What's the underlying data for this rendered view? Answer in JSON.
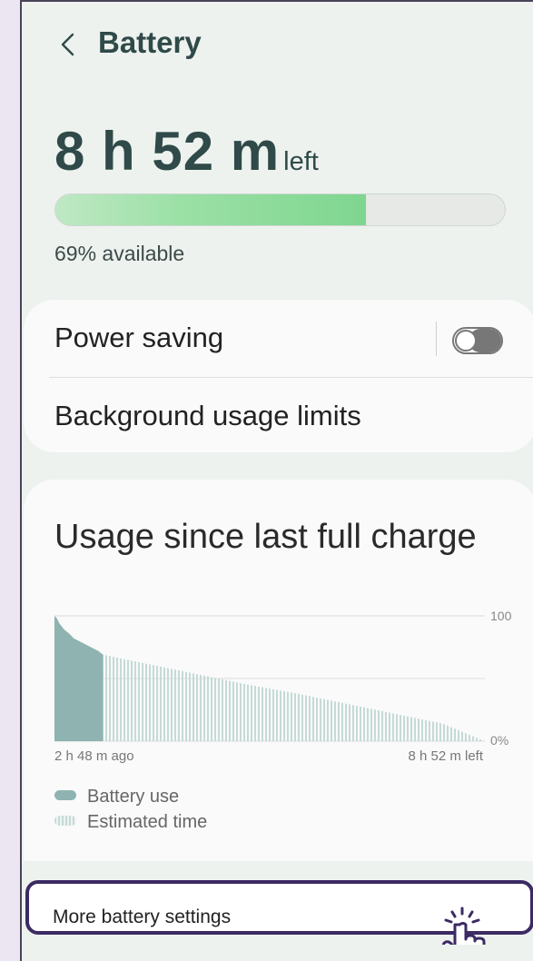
{
  "header": {
    "back_icon": "chevron-left-icon",
    "title": "Battery"
  },
  "battery": {
    "time_left_main": "8 h 52 m",
    "time_left_suffix": "left",
    "level_percent": 69,
    "available_text": "69% available",
    "bar_color": "#7fd68f"
  },
  "settings": {
    "power_saving_label": "Power saving",
    "power_saving_enabled": false,
    "background_limits_label": "Background usage limits"
  },
  "usage": {
    "title": "Usage since last full charge",
    "chart_data": {
      "type": "area",
      "x_start_label": "2 h 48 m ago",
      "x_end_label": "8 h 52 m left",
      "y_ticks": [
        "100",
        "0%"
      ],
      "ylim": [
        0,
        100
      ],
      "series": [
        {
          "name": "Battery use",
          "color": "#8fb3b0",
          "x": [
            0,
            0.05,
            0.1,
            0.2,
            0.3,
            0.4,
            0.5,
            0.6,
            0.7,
            0.8,
            0.9,
            1.0
          ],
          "y": [
            100,
            98,
            94,
            89,
            86,
            82,
            80,
            78,
            76,
            74,
            72,
            69
          ]
        },
        {
          "name": "Estimated time",
          "color": "#c5dad7",
          "x": [
            1.0,
            2.0,
            3.0,
            4.0,
            5.0,
            6.0,
            7.0,
            8.0,
            8.87
          ],
          "y": [
            69,
            61,
            53,
            45,
            38,
            30,
            22,
            14,
            0
          ]
        }
      ],
      "legend": [
        "Battery use",
        "Estimated time"
      ]
    }
  },
  "more": {
    "label": "More battery settings",
    "pointer_icon": "tap-hand-icon"
  }
}
